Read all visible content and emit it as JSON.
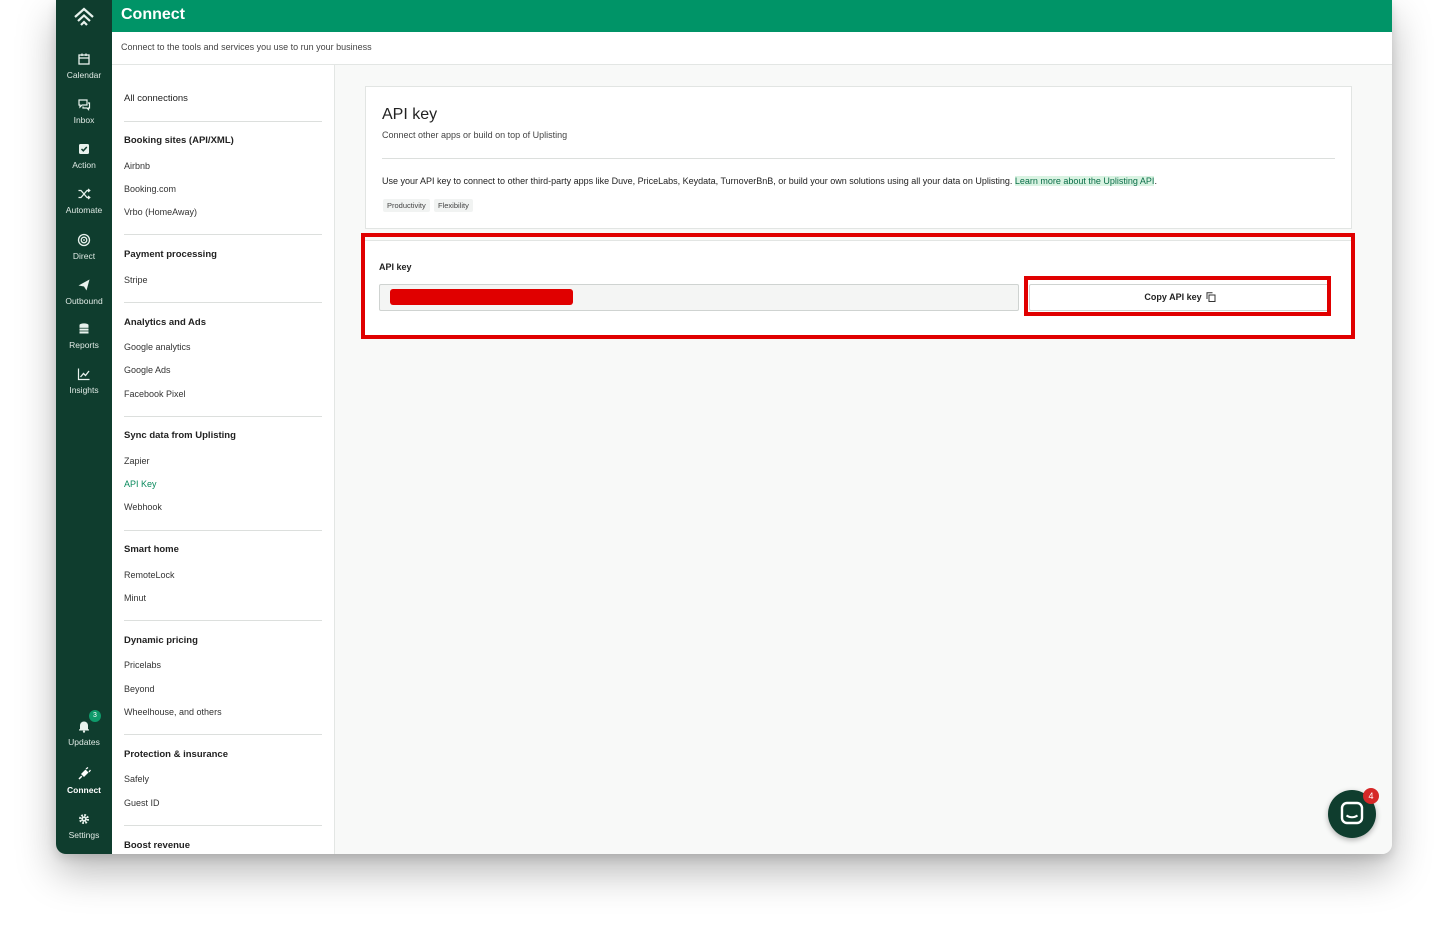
{
  "header": {
    "title": "Connect",
    "subtitle": "Connect to the tools and services you use to run your business"
  },
  "rail": {
    "items": [
      {
        "label": "Calendar",
        "icon": "calendar-icon"
      },
      {
        "label": "Inbox",
        "icon": "chat-bubbles-icon"
      },
      {
        "label": "Action",
        "icon": "checkbox-icon"
      },
      {
        "label": "Automate",
        "icon": "shuffle-icon"
      },
      {
        "label": "Direct",
        "icon": "target-icon"
      },
      {
        "label": "Outbound",
        "icon": "send-icon"
      },
      {
        "label": "Reports",
        "icon": "database-icon"
      },
      {
        "label": "Insights",
        "icon": "trend-chart-icon"
      }
    ],
    "bottom": [
      {
        "label": "Updates",
        "icon": "bell-icon",
        "badge": "3"
      },
      {
        "label": "Connect",
        "icon": "plug-icon"
      },
      {
        "label": "Settings",
        "icon": "gear-icon"
      }
    ]
  },
  "sidebar": {
    "all": "All connections",
    "sections": [
      {
        "title": "Booking sites (API/XML)",
        "items": [
          "Airbnb",
          "Booking.com",
          "Vrbo (HomeAway)"
        ]
      },
      {
        "title": "Payment processing",
        "items": [
          "Stripe"
        ]
      },
      {
        "title": "Analytics and Ads",
        "items": [
          "Google analytics",
          "Google Ads",
          "Facebook Pixel"
        ]
      },
      {
        "title": "Sync data from Uplisting",
        "items": [
          "Zapier",
          "API Key",
          "Webhook"
        ]
      },
      {
        "title": "Smart home",
        "items": [
          "RemoteLock",
          "Minut"
        ]
      },
      {
        "title": "Dynamic pricing",
        "items": [
          "Pricelabs",
          "Beyond",
          "Wheelhouse, and others"
        ]
      },
      {
        "title": "Protection & insurance",
        "items": [
          "Safely",
          "Guest ID"
        ]
      },
      {
        "title": "Boost revenue",
        "items": []
      }
    ],
    "active": "API Key"
  },
  "card": {
    "title": "API key",
    "subtitle": "Connect other apps or build on top of Uplisting",
    "description": "Use your API key to connect to other third-party apps like Duve, PriceLabs, Keydata, TurnoverBnB, or build your own solutions using all your data on Uplisting. ",
    "link": "Learn more about the Uplisting API",
    "tags": [
      "Productivity",
      "Flexibility"
    ]
  },
  "api_key": {
    "label": "API key",
    "copy_label": "Copy API key"
  },
  "chat": {
    "badge": "4"
  },
  "colors": {
    "brand": "#009467",
    "rail": "#0f3d2e",
    "highlight": "#e00000",
    "active_link": "#0a8a5d"
  }
}
